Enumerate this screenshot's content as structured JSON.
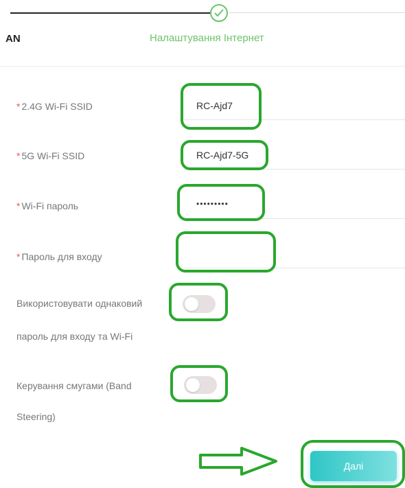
{
  "stepper": {
    "prev_step": "AN",
    "current_step": "Налаштування Інтернет"
  },
  "form": {
    "ssid24": {
      "label": "2.4G Wi-Fi SSID",
      "value": "RC-Ajd7"
    },
    "ssid5": {
      "label": "5G Wi-Fi SSID",
      "value": "RC-Ajd7-5G"
    },
    "wifi_password": {
      "label": "Wi-Fi пароль",
      "value": "•••••••••"
    },
    "login_password": {
      "label": "Пароль для входу",
      "value": ""
    },
    "same_password": {
      "label_line1": "Використовувати однаковий",
      "label_line2": "пароль для входу та Wi-Fi",
      "enabled": false
    },
    "band_steering": {
      "label_line1": "Керування смугами (Band",
      "label_line2": "Steering)",
      "enabled": false
    },
    "required_marker": "*"
  },
  "actions": {
    "next_label": "Далі"
  },
  "colors": {
    "accent_green": "#6cc36b",
    "highlight_green": "#2aa72e",
    "button_teal": "#2fc6c6",
    "required_red": "#e55d5d"
  }
}
